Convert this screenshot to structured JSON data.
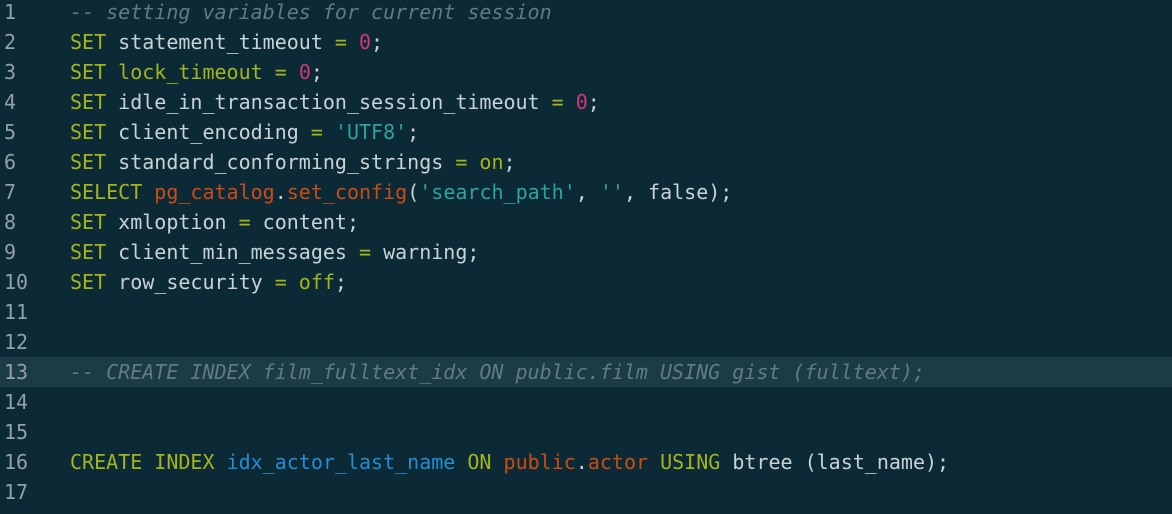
{
  "theme": {
    "background": "#0c2a36",
    "active_line": "#1b3b47",
    "comment": "#5f7c86",
    "keyword": "#a4b51a",
    "number": "#d1357e",
    "string": "#2fa39a",
    "schema": "#cb4b16",
    "index_name": "#268bd2",
    "text": "#c8d3d5",
    "gutter": "#93a1a4"
  },
  "active_line": 13,
  "lines": [
    {
      "n": "1",
      "tokens": [
        {
          "t": "-- setting variables for current session",
          "c": "comment"
        }
      ]
    },
    {
      "n": "2",
      "tokens": [
        {
          "t": "SET",
          "c": "keyword"
        },
        {
          "t": " statement_timeout ",
          "c": "ident"
        },
        {
          "t": "=",
          "c": "op"
        },
        {
          "t": " ",
          "c": "ident"
        },
        {
          "t": "0",
          "c": "number"
        },
        {
          "t": ";",
          "c": "punct"
        }
      ]
    },
    {
      "n": "3",
      "tokens": [
        {
          "t": "SET",
          "c": "keyword"
        },
        {
          "t": " ",
          "c": "ident"
        },
        {
          "t": "lock_timeout",
          "c": "keyword"
        },
        {
          "t": " ",
          "c": "ident"
        },
        {
          "t": "=",
          "c": "op"
        },
        {
          "t": " ",
          "c": "ident"
        },
        {
          "t": "0",
          "c": "number"
        },
        {
          "t": ";",
          "c": "punct"
        }
      ]
    },
    {
      "n": "4",
      "tokens": [
        {
          "t": "SET",
          "c": "keyword"
        },
        {
          "t": " idle_in_transaction_session_timeout ",
          "c": "ident"
        },
        {
          "t": "=",
          "c": "op"
        },
        {
          "t": " ",
          "c": "ident"
        },
        {
          "t": "0",
          "c": "number"
        },
        {
          "t": ";",
          "c": "punct"
        }
      ]
    },
    {
      "n": "5",
      "tokens": [
        {
          "t": "SET",
          "c": "keyword"
        },
        {
          "t": " client_encoding ",
          "c": "ident"
        },
        {
          "t": "=",
          "c": "op"
        },
        {
          "t": " ",
          "c": "ident"
        },
        {
          "t": "'UTF8'",
          "c": "string"
        },
        {
          "t": ";",
          "c": "punct"
        }
      ]
    },
    {
      "n": "6",
      "tokens": [
        {
          "t": "SET",
          "c": "keyword"
        },
        {
          "t": " standard_conforming_strings ",
          "c": "ident"
        },
        {
          "t": "=",
          "c": "op"
        },
        {
          "t": " ",
          "c": "ident"
        },
        {
          "t": "on",
          "c": "kwval"
        },
        {
          "t": ";",
          "c": "punct"
        }
      ]
    },
    {
      "n": "7",
      "tokens": [
        {
          "t": "SELECT",
          "c": "keyword"
        },
        {
          "t": " ",
          "c": "ident"
        },
        {
          "t": "pg_catalog",
          "c": "schema"
        },
        {
          "t": ".",
          "c": "punct"
        },
        {
          "t": "set_config",
          "c": "func"
        },
        {
          "t": "(",
          "c": "punct"
        },
        {
          "t": "'search_path'",
          "c": "string"
        },
        {
          "t": ", ",
          "c": "punct"
        },
        {
          "t": "''",
          "c": "string"
        },
        {
          "t": ", false);",
          "c": "punct"
        }
      ]
    },
    {
      "n": "8",
      "tokens": [
        {
          "t": "SET",
          "c": "keyword"
        },
        {
          "t": " xmloption ",
          "c": "ident"
        },
        {
          "t": "=",
          "c": "op"
        },
        {
          "t": " content;",
          "c": "ident"
        }
      ]
    },
    {
      "n": "9",
      "tokens": [
        {
          "t": "SET",
          "c": "keyword"
        },
        {
          "t": " client_min_messages ",
          "c": "ident"
        },
        {
          "t": "=",
          "c": "op"
        },
        {
          "t": " warning;",
          "c": "ident"
        }
      ]
    },
    {
      "n": "10",
      "tokens": [
        {
          "t": "SET",
          "c": "keyword"
        },
        {
          "t": " row_security ",
          "c": "ident"
        },
        {
          "t": "=",
          "c": "op"
        },
        {
          "t": " ",
          "c": "ident"
        },
        {
          "t": "off",
          "c": "kwval"
        },
        {
          "t": ";",
          "c": "punct"
        }
      ]
    },
    {
      "n": "11",
      "tokens": []
    },
    {
      "n": "12",
      "tokens": []
    },
    {
      "n": "13",
      "tokens": [
        {
          "t": "-- CREATE INDEX film_fulltext_idx ON public.film USING gist (fulltext);",
          "c": "comment"
        }
      ]
    },
    {
      "n": "14",
      "tokens": []
    },
    {
      "n": "15",
      "tokens": []
    },
    {
      "n": "16",
      "tokens": [
        {
          "t": "CREATE",
          "c": "keyword"
        },
        {
          "t": " ",
          "c": "ident"
        },
        {
          "t": "INDEX",
          "c": "keyword"
        },
        {
          "t": " ",
          "c": "ident"
        },
        {
          "t": "idx_actor_last_name",
          "c": "index"
        },
        {
          "t": " ",
          "c": "ident"
        },
        {
          "t": "ON",
          "c": "keyword"
        },
        {
          "t": " ",
          "c": "ident"
        },
        {
          "t": "public",
          "c": "schema"
        },
        {
          "t": ".",
          "c": "punct"
        },
        {
          "t": "actor",
          "c": "schema"
        },
        {
          "t": " ",
          "c": "ident"
        },
        {
          "t": "USING",
          "c": "keyword"
        },
        {
          "t": " btree (last_name);",
          "c": "ident"
        }
      ]
    },
    {
      "n": "17",
      "tokens": []
    }
  ]
}
